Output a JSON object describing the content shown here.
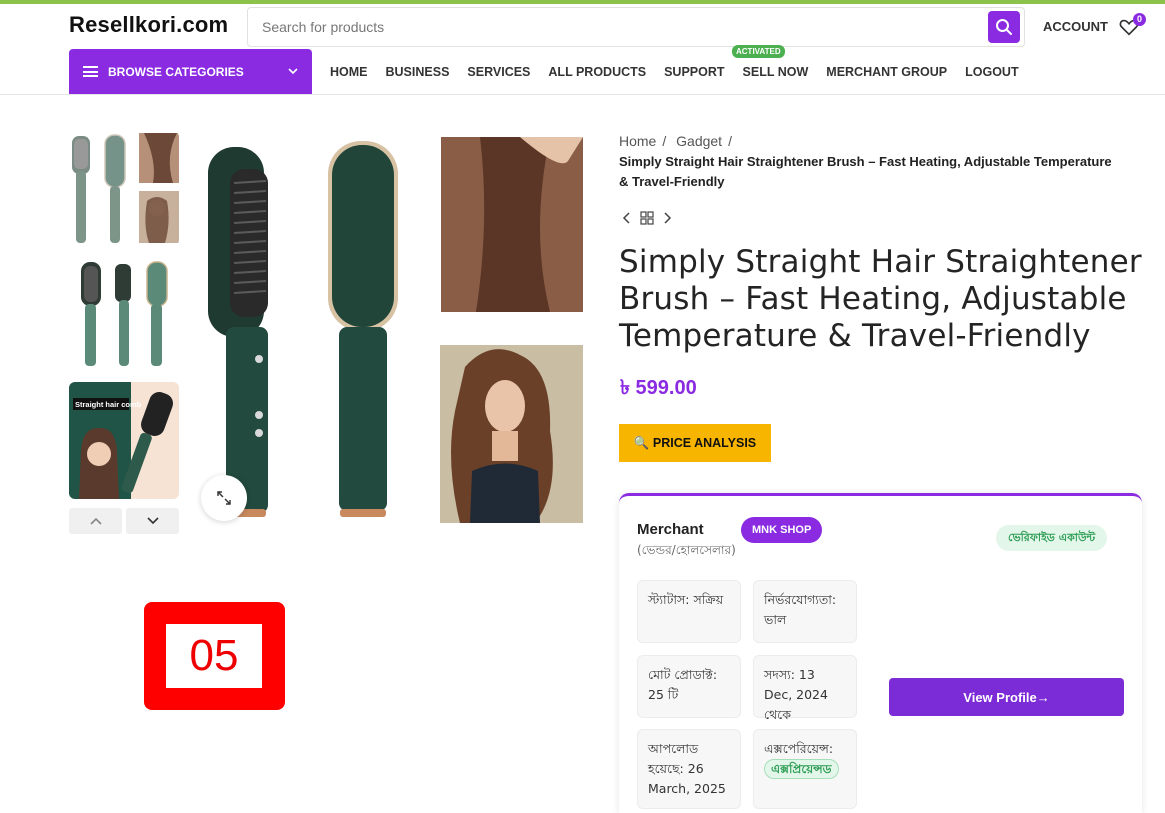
{
  "header": {
    "logo": "Resellkori.com",
    "search_placeholder": "Search for products",
    "account": "ACCOUNT",
    "wishlist_count": "0"
  },
  "nav": {
    "browse": "BROWSE CATEGORIES",
    "items": [
      "HOME",
      "BUSINESS",
      "SERVICES",
      "ALL PRODUCTS",
      "SUPPORT",
      "SELL NOW",
      "MERCHANT GROUP",
      "LOGOUT"
    ],
    "sell_now_badge": "ACTIVATED"
  },
  "gallery": {
    "overlay_number": "05",
    "thumb3_caption": "Straight hair comb"
  },
  "breadcrumb": {
    "home": "Home",
    "sep": "/",
    "category": "Gadget",
    "current": "Simply Straight Hair Straightener Brush – Fast Heating, Adjustable Temperature & Travel-Friendly"
  },
  "product": {
    "title": "Simply Straight Hair Straightener Brush – Fast Heating, Adjustable Temperature & Travel-Friendly",
    "price": "৳ 599.00",
    "price_analysis": "🔍 PRICE ANALYSIS"
  },
  "merchant": {
    "label": "Merchant",
    "sub": "(ভেন্ডর/হোলসেলার)",
    "shop": "MNK SHOP",
    "verified": "ভেরিফাইড একাউন্ট",
    "stats": {
      "status": "স্ট্যাটাস: সক্রিয়",
      "reliability": "নির্ভরযোগ্যতা: ভাল",
      "total_products": "মোট প্রোডাক্ট: 25 টি",
      "member": "সদস্য: 13 Dec, 2024 থেকে",
      "uploaded": "আপলোড হয়েছে: 26 March, 2025",
      "experience_label": "এক্সপেরিয়েন্স:",
      "experience_value": "এক্সপ্রিয়েন্সড"
    },
    "view_profile": "View Profile→"
  },
  "colors": {
    "accent": "#8a2be2",
    "button_yellow": "#f7b500",
    "verified_green": "#2e9e55",
    "top_bar": "#8bc34a"
  }
}
